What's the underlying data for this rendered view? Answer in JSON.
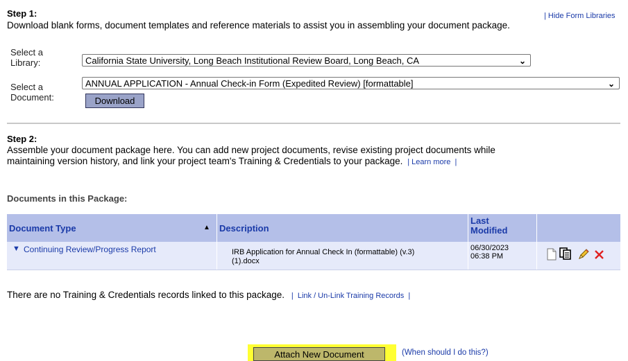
{
  "step1": {
    "title": "Step 1:",
    "hide_link": "Hide Form Libraries",
    "description": "Download blank forms, document templates and reference materials to assist you in assembling your document package.",
    "library_label_1": "Select a",
    "library_label_2": "Library:",
    "library_value": "California State University, Long Beach Institutional Review Board, Long Beach, CA",
    "document_label_1": "Select a",
    "document_label_2": "Document:",
    "document_value": "ANNUAL APPLICATION - Annual Check-in Form (Expedited Review) [formattable]",
    "download_label": "Download"
  },
  "step2": {
    "title": "Step 2:",
    "description_line1": "Assemble your document package here. You can add new project documents, revise existing project documents while",
    "description_line2": "maintaining version history, and link your project team's Training & Credentials to your package.",
    "learn_more": "Learn more"
  },
  "package": {
    "heading": "Documents in this Package:",
    "columns": {
      "type": "Document Type",
      "description": "Description",
      "last_1": "Last",
      "last_2": "Modified"
    },
    "rows": [
      {
        "type": "Continuing Review/Progress Report",
        "description_line1": "IRB Application for Annual Check In (formattable) (v.3)",
        "description_line2": "(1).docx",
        "date": "06/30/2023",
        "time": "06:38 PM"
      }
    ]
  },
  "training": {
    "text": "There are no Training & Credentials records linked to this package.",
    "link": "Link / Un-Link Training Records"
  },
  "attach": {
    "button": "Attach New Document",
    "help_link": "(When should I do this?)"
  },
  "icons": {
    "view": "document-icon",
    "copy": "copy-icon",
    "edit": "pencil-icon",
    "delete": "delete-x-icon",
    "sort": "sort-up-icon",
    "expand": "expand-triangle-icon"
  },
  "colors": {
    "link": "#1a3aa8",
    "header_bg": "#b4bfe8",
    "row_bg": "#e6eafa",
    "highlight": "#ffff33",
    "delete": "#e02020"
  }
}
